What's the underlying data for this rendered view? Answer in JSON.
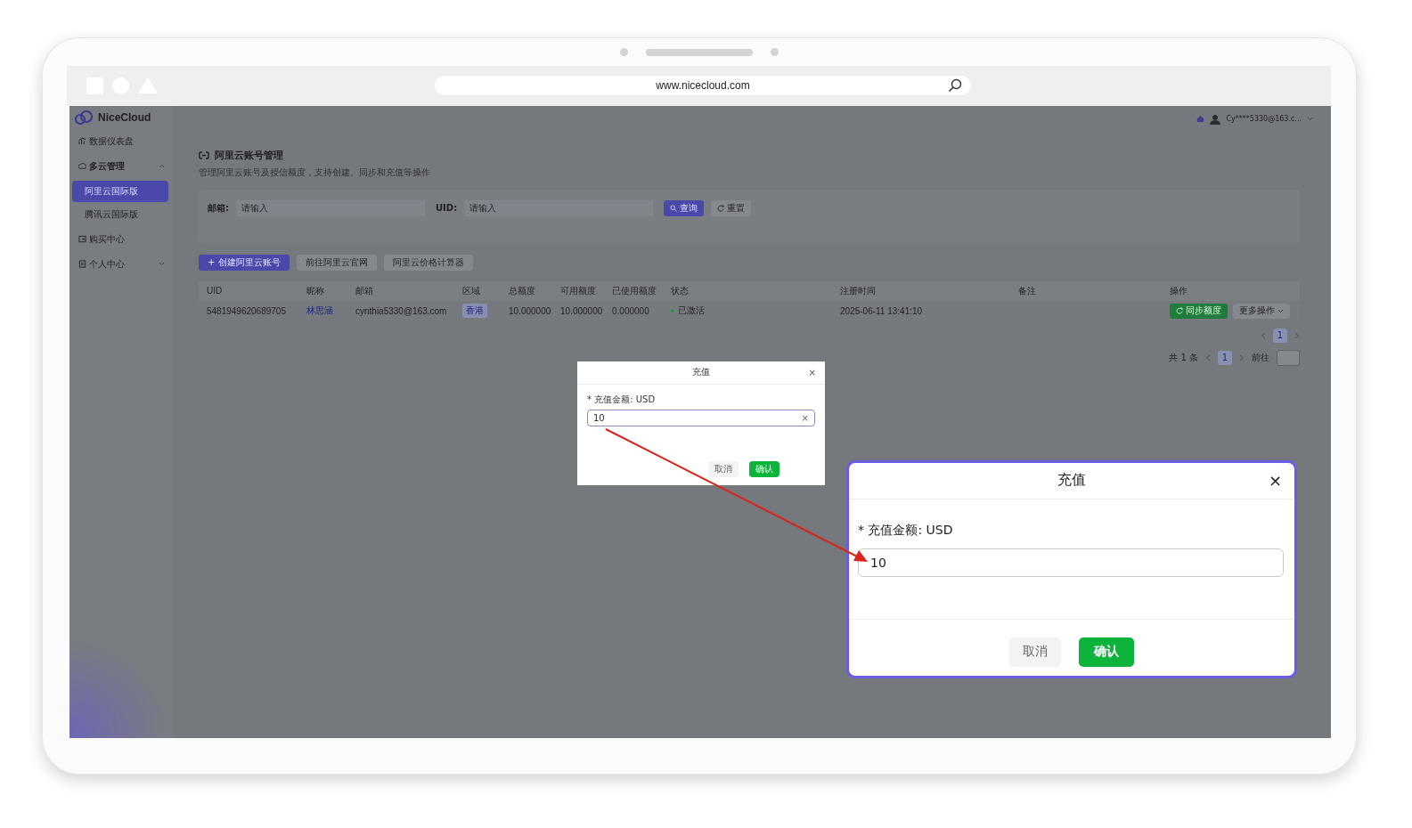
{
  "browser": {
    "url": "www.nicecloud.com"
  },
  "brand": "NiceCloud",
  "sidebar": {
    "items": [
      {
        "label": "数据仪表盘",
        "kind": "dashboard",
        "selected": false
      },
      {
        "label": "多云管理",
        "kind": "cloud",
        "selected": false,
        "expanded": true,
        "children": [
          {
            "label": "阿里云国际版",
            "selected": true
          },
          {
            "label": "腾讯云国际版",
            "selected": false
          }
        ]
      },
      {
        "label": "购买中心",
        "kind": "wallet",
        "selected": false
      },
      {
        "label": "个人中心",
        "kind": "profile",
        "selected": false,
        "expanded": false
      }
    ]
  },
  "header": {
    "user": "Cy****5330@163.c..."
  },
  "page": {
    "title": "阿里云账号管理",
    "subtitle": "管理阿里云账号及授信额度，支持创建、同步和充值等操作"
  },
  "filters": [
    {
      "label": "邮箱:",
      "placeholder": "请输入"
    },
    {
      "label": "UID:",
      "placeholder": "请输入"
    }
  ],
  "filter_buttons": [
    {
      "label": "查询",
      "kind": "primary"
    },
    {
      "label": "重置",
      "kind": "plain"
    }
  ],
  "actions": [
    {
      "label": "+ 创建阿里云账号",
      "kind": "primary"
    },
    {
      "label": "前往阿里云官网",
      "kind": "link"
    },
    {
      "label": "阿里云价格计算器",
      "kind": "calculator"
    }
  ],
  "table": {
    "columns": [
      "UID",
      "昵称",
      "邮箱",
      "区域",
      "总额度",
      "可用额度",
      "已使用额度",
      "状态",
      "注册时间",
      "备注",
      "操作"
    ],
    "rows": [
      {
        "uid": "5481949620689705",
        "nickname": "林思涵",
        "email": "cynthia5330@163.com",
        "region": "香港",
        "total": "10.000000",
        "available": "10.000000",
        "used": "0.000000",
        "status": "已激活",
        "registered": "2025-06-11 13:41:10",
        "sync": "同步额度",
        "more": "更多操作"
      }
    ]
  },
  "pagination_top": {
    "pages": [
      {
        "label": "1",
        "selected": true
      }
    ]
  },
  "pagination_bottom": {
    "total": "共 1 条",
    "pages": [
      {
        "label": "1",
        "selected": true
      }
    ],
    "goto": "前往"
  },
  "dialog": {
    "title": "充值",
    "close": "×",
    "label": "* 充值金额: USD",
    "value": "10",
    "clear": "×",
    "cancel": "取消",
    "confirm": "确认"
  },
  "dialog_zoom": {
    "title": "充值",
    "close": "×",
    "label": "* 充值金额: USD",
    "value": "10",
    "cancel": "取消",
    "confirm": "确认"
  }
}
